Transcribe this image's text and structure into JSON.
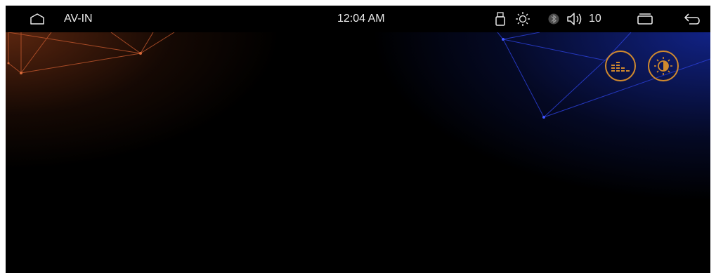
{
  "statusbar": {
    "source_label": "AV-IN",
    "time": "12:04 AM",
    "volume": "10",
    "icons": [
      "home-icon",
      "usb-icon",
      "brightness-icon",
      "bluetooth-icon",
      "volume-icon",
      "recent-apps-icon",
      "back-icon"
    ]
  },
  "controls": {
    "icons": [
      "equalizer-icon",
      "contrast-icon"
    ],
    "accent_color": "#d18a2e"
  },
  "background": {
    "left_glow": "#7a3214",
    "right_glow": "#12248c",
    "network_left_color": "#c4582e",
    "network_right_color": "#2b3fd6"
  }
}
